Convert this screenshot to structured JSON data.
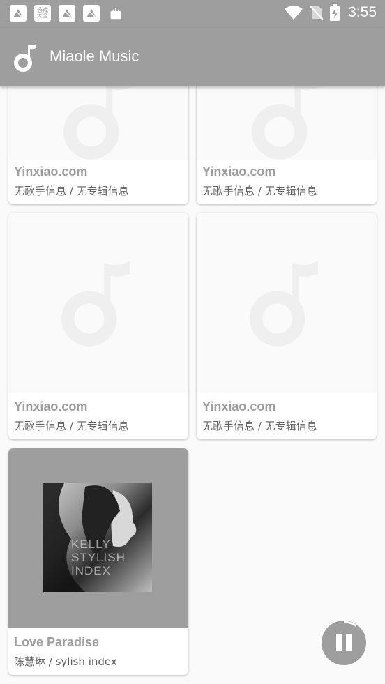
{
  "status_bar": {
    "time": "3:55",
    "notification_icons": [
      "notification-icon-1",
      "game-center-icon",
      "notification-icon-2",
      "notification-icon-3",
      "shopping-bag-icon"
    ],
    "game_center_text": "游戏\n大全",
    "right_icons": [
      "wifi-icon",
      "no-sim-icon",
      "battery-charging-icon"
    ]
  },
  "app_bar": {
    "title": "Miaole Music",
    "logo": "music-note-icon"
  },
  "songs": [
    {
      "title": "Yinxiao.com",
      "subtitle": "无歌手信息 / 无专辑信息",
      "art": "placeholder"
    },
    {
      "title": "Yinxiao.com",
      "subtitle": "无歌手信息 / 无专辑信息",
      "art": "placeholder"
    },
    {
      "title": "Yinxiao.com",
      "subtitle": "无歌手信息 / 无专辑信息",
      "art": "placeholder"
    },
    {
      "title": "Yinxiao.com",
      "subtitle": "无歌手信息 / 无专辑信息",
      "art": "placeholder"
    },
    {
      "title": "Love Paradise",
      "subtitle": "陈慧琳 / sylish index",
      "art": "album-cover",
      "cover_text": "KELLY\nSTYLISH\nINDEX"
    }
  ],
  "player": {
    "state_icon": "pause-icon",
    "progress": 0.1
  },
  "colors": {
    "primary": "#9e9e9e",
    "background": "#fafafa",
    "card": "#ffffff",
    "placeholder_icon": "#efefef"
  }
}
